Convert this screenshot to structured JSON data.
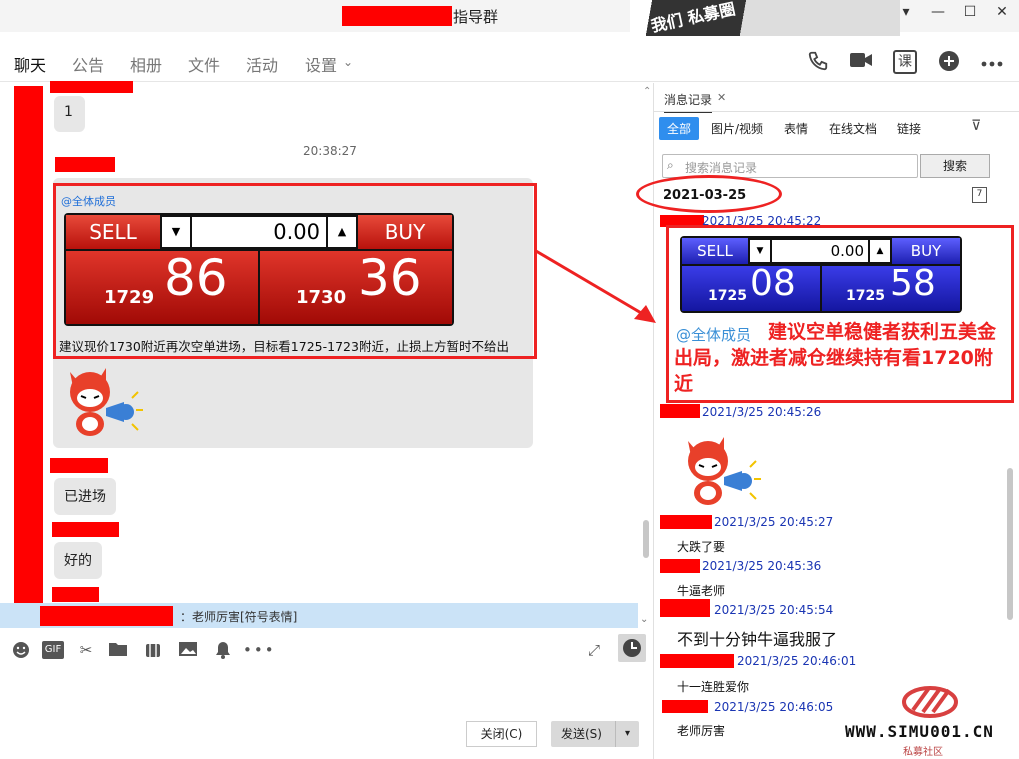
{
  "window": {
    "title": "指导群",
    "banner_text": "我们 私募圈",
    "controls": [
      "▾",
      "—",
      "☐",
      "✕"
    ]
  },
  "nav": {
    "tabs": [
      "聊天",
      "公告",
      "相册",
      "文件",
      "活动",
      "设置"
    ],
    "settings_arrow": "⌄",
    "right_icons": [
      "phone-icon",
      "video-icon",
      "lesson-icon",
      "add-icon",
      "more-icon"
    ],
    "lesson_label": "课"
  },
  "chat": {
    "msg1": "1",
    "time1": "20:38:27",
    "mention": "@全体成员",
    "trade1": {
      "sell_label": "SELL",
      "buy_label": "BUY",
      "price_input": "0.00",
      "sell_big_prefix": "1729",
      "sell_big_num": "86",
      "buy_big_prefix": "1730",
      "buy_big_num": "36"
    },
    "instruction": "建议现价1730附近再次空单进场，目标看1725-1723附近，止损上方暂时不给出",
    "msg_entered": "已进场",
    "msg_ok": "好的",
    "reply_text": "：老师厉害[符号表情]"
  },
  "input": {
    "close": "关闭(C)",
    "send": "发送(S)",
    "send_arrow": "▾"
  },
  "history": {
    "tab": "消息记录",
    "tab_close": "✕",
    "filters": [
      "全部",
      "图片/视频",
      "表情",
      "在线文档",
      "链接"
    ],
    "search_placeholder": "搜索消息记录",
    "search_btn": "搜索",
    "date": "2021-03-25",
    "calendar_day": "7",
    "meta1": "2021/3/25 20:45:22",
    "trade2": {
      "sell_label": "SELL",
      "buy_label": "BUY",
      "price_input": "0.00",
      "sell_big_prefix": "1725",
      "sell_big_num": "08",
      "buy_big_prefix": "1725",
      "buy_big_num": "58"
    },
    "mention": "@全体成员",
    "red_note": "建议空单稳健者获利五美金出局，激进者减仓继续持有看1720附近",
    "meta2": "2021/3/25 20:45:26",
    "meta3": "2021/3/25 20:45:27",
    "msg3": "大跌了要",
    "meta4": "2021/3/25 20:45:36",
    "msg4": "牛逼老师",
    "meta5": "2021/3/25 20:45:54",
    "msg5": "不到十分钟牛逼我服了",
    "meta6": "2021/3/25 20:46:01",
    "msg6": "十一连胜爱你",
    "meta7": "2021/3/25 20:46:05",
    "msg7": "老师厉害"
  },
  "watermark": {
    "text": "WWW.SIMU001.CN",
    "sub": "私募社区"
  }
}
